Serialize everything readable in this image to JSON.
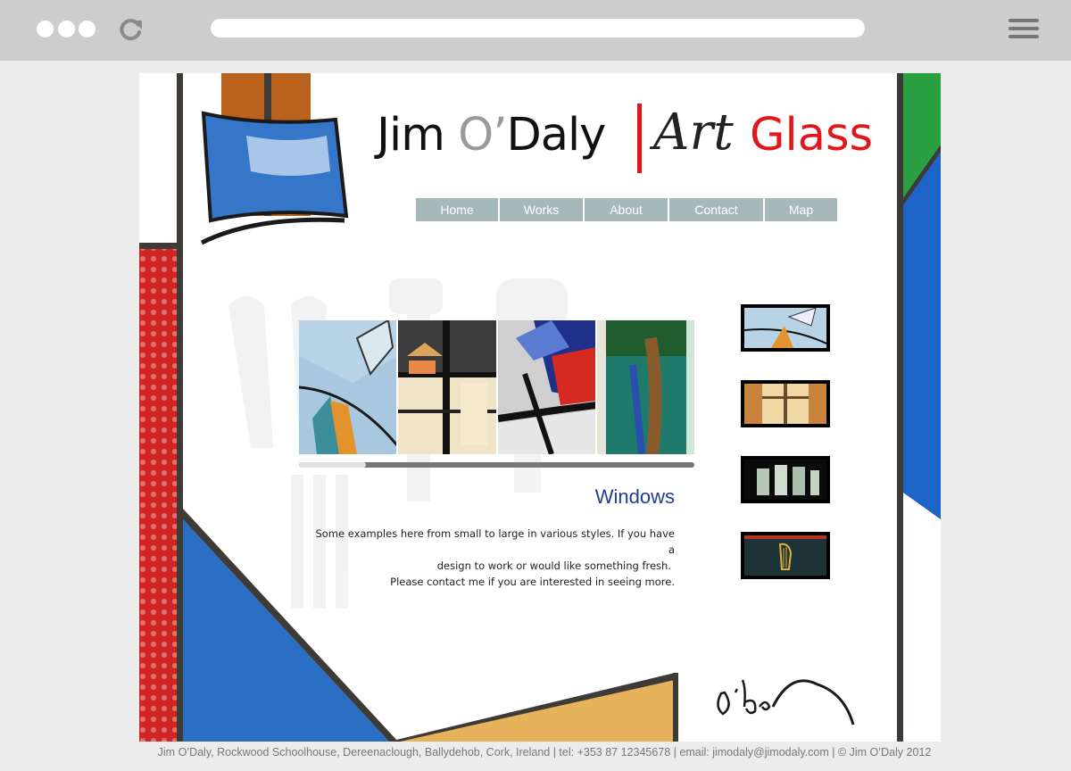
{
  "browser": {
    "window_dots": [
      "dot-1",
      "dot-2",
      "dot-3"
    ],
    "reload_icon": "reload-icon",
    "menu_icon": "hamburger-menu-icon"
  },
  "logo": {
    "first": "Jim ",
    "od": "O’",
    "last": "Daly",
    "art": "Art",
    "glass": "Glass"
  },
  "nav": [
    {
      "label": "Home"
    },
    {
      "label": "Works"
    },
    {
      "label": "About"
    },
    {
      "label": "Contact"
    },
    {
      "label": "Map"
    }
  ],
  "gallery": {
    "slider_position": 0.17,
    "section_title": "Windows",
    "description_lines": [
      "Some examples here from small to large in various styles. If you have a",
      "design to work or would like something fresh.",
      "Please contact me if you are interested in seeing more."
    ]
  },
  "thumbnails": [
    "windows-thumb",
    "panel-thumb",
    "glass-thumb",
    "harp-thumb"
  ],
  "footer": {
    "text": "Jim O’Daly, Rockwood Schoolhouse, Dereenaclough, Ballydehob, Cork, Ireland  |  tel: +353 87 12345678  |  email: jimodaly@jimodaly.com  |  © Jim O’Daly 2012"
  },
  "colors": {
    "accent_red": "#e0171b",
    "nav_bg": "#a6b8ba",
    "title_blue": "#1d3f8f"
  }
}
